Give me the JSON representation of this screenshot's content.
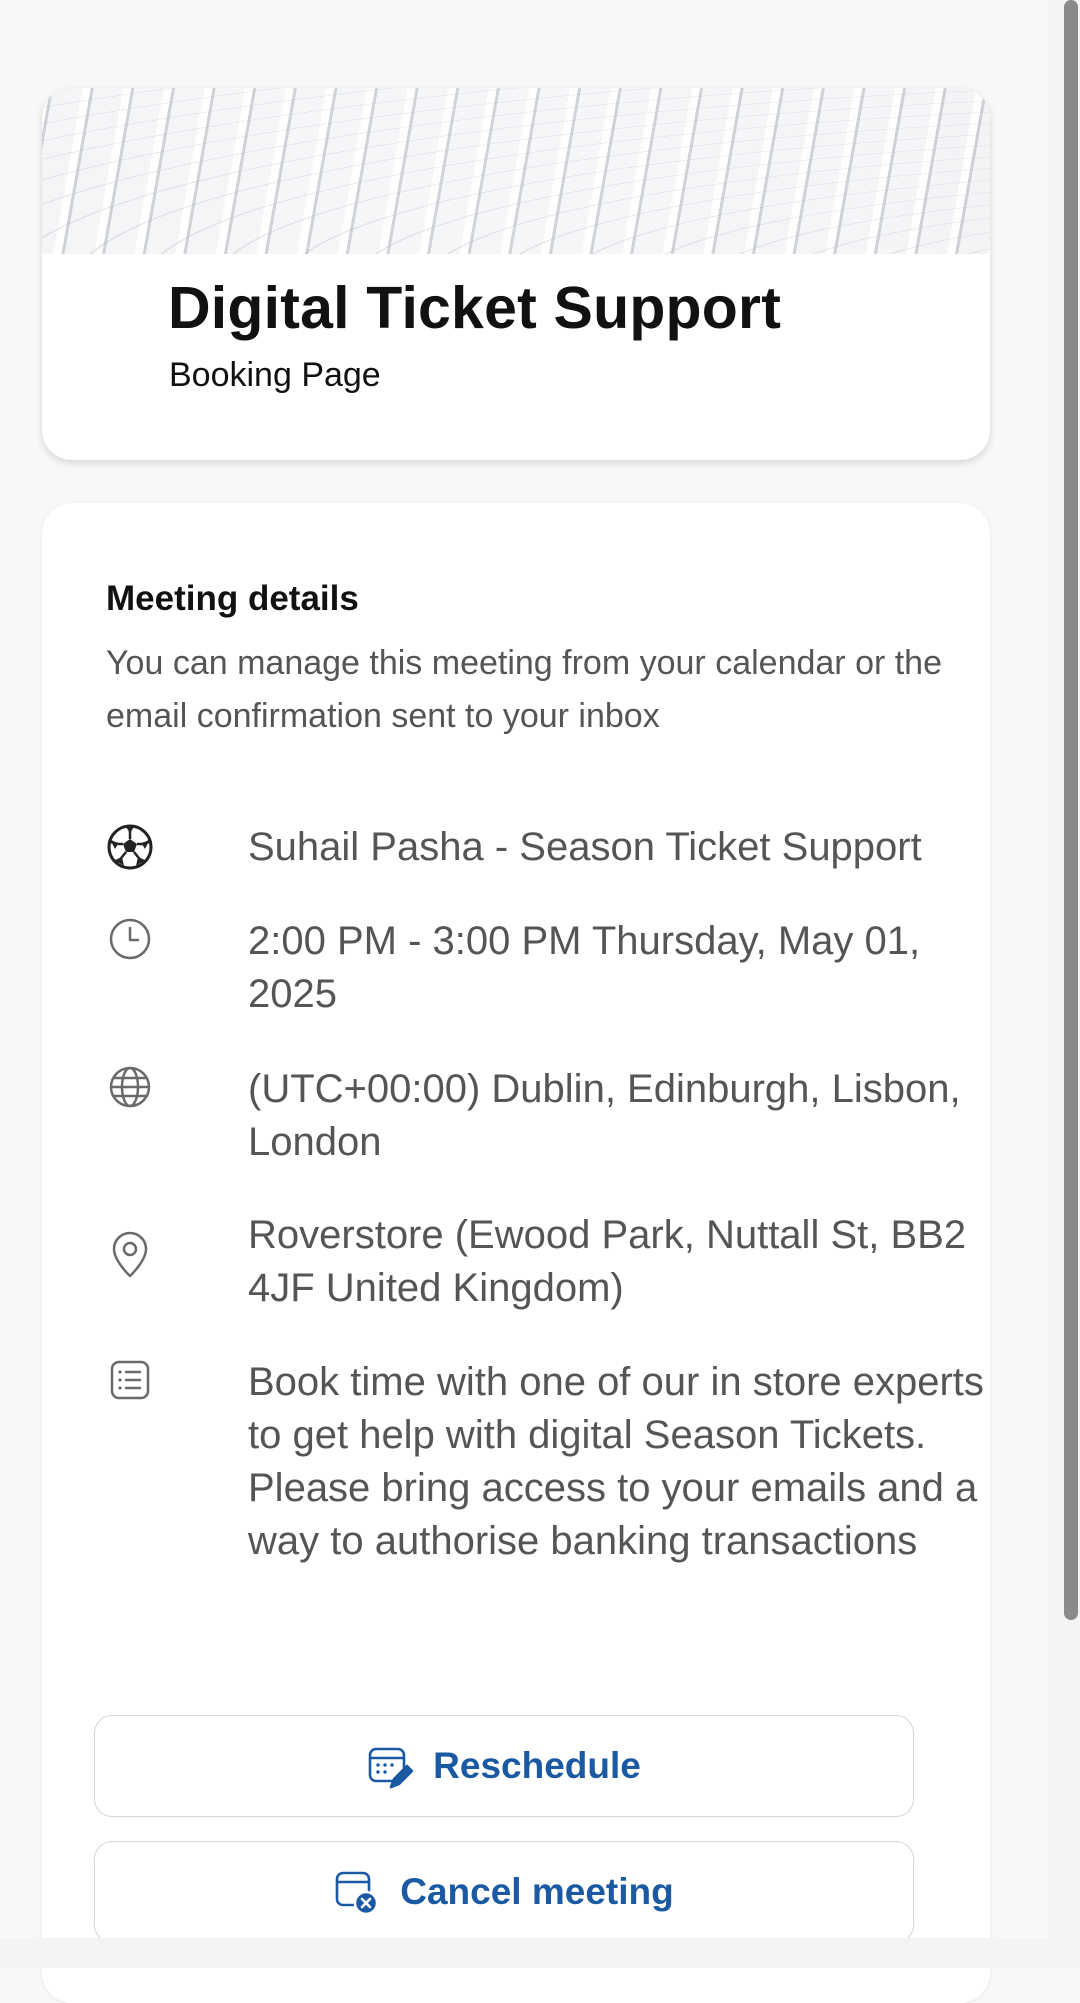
{
  "header": {
    "title": "Digital Ticket Support",
    "subtitle": "Booking Page"
  },
  "meeting": {
    "section_title": "Meeting details",
    "description": "You can manage this meeting from your calendar or the email confirmation sent to your inbox",
    "service": {
      "icon": "soccer-ball-icon",
      "text": "Suhail Pasha - Season Ticket Support"
    },
    "time": {
      "icon": "clock-icon",
      "text": "2:00 PM - 3:00 PM Thursday, May 01, 2025"
    },
    "timezone": {
      "icon": "globe-icon",
      "text": "(UTC+00:00) Dublin, Edinburgh, Lisbon, London"
    },
    "location": {
      "icon": "location-pin-icon",
      "text": "Roverstore (Ewood Park, Nuttall St, BB2 4JF United Kingdom)"
    },
    "notes": {
      "icon": "list-icon",
      "text": "Book time with one of our in store experts to get help with digital Season Tickets. Please bring access to your emails and a way to authorise banking transactions"
    }
  },
  "actions": {
    "reschedule": {
      "icon": "calendar-edit-icon",
      "label": "Reschedule"
    },
    "cancel": {
      "icon": "calendar-cancel-icon",
      "label": "Cancel meeting"
    }
  },
  "colors": {
    "accent": "#1b5aa3",
    "background": "#f8f8f8",
    "card": "#ffffff",
    "muted_text": "#555555"
  }
}
